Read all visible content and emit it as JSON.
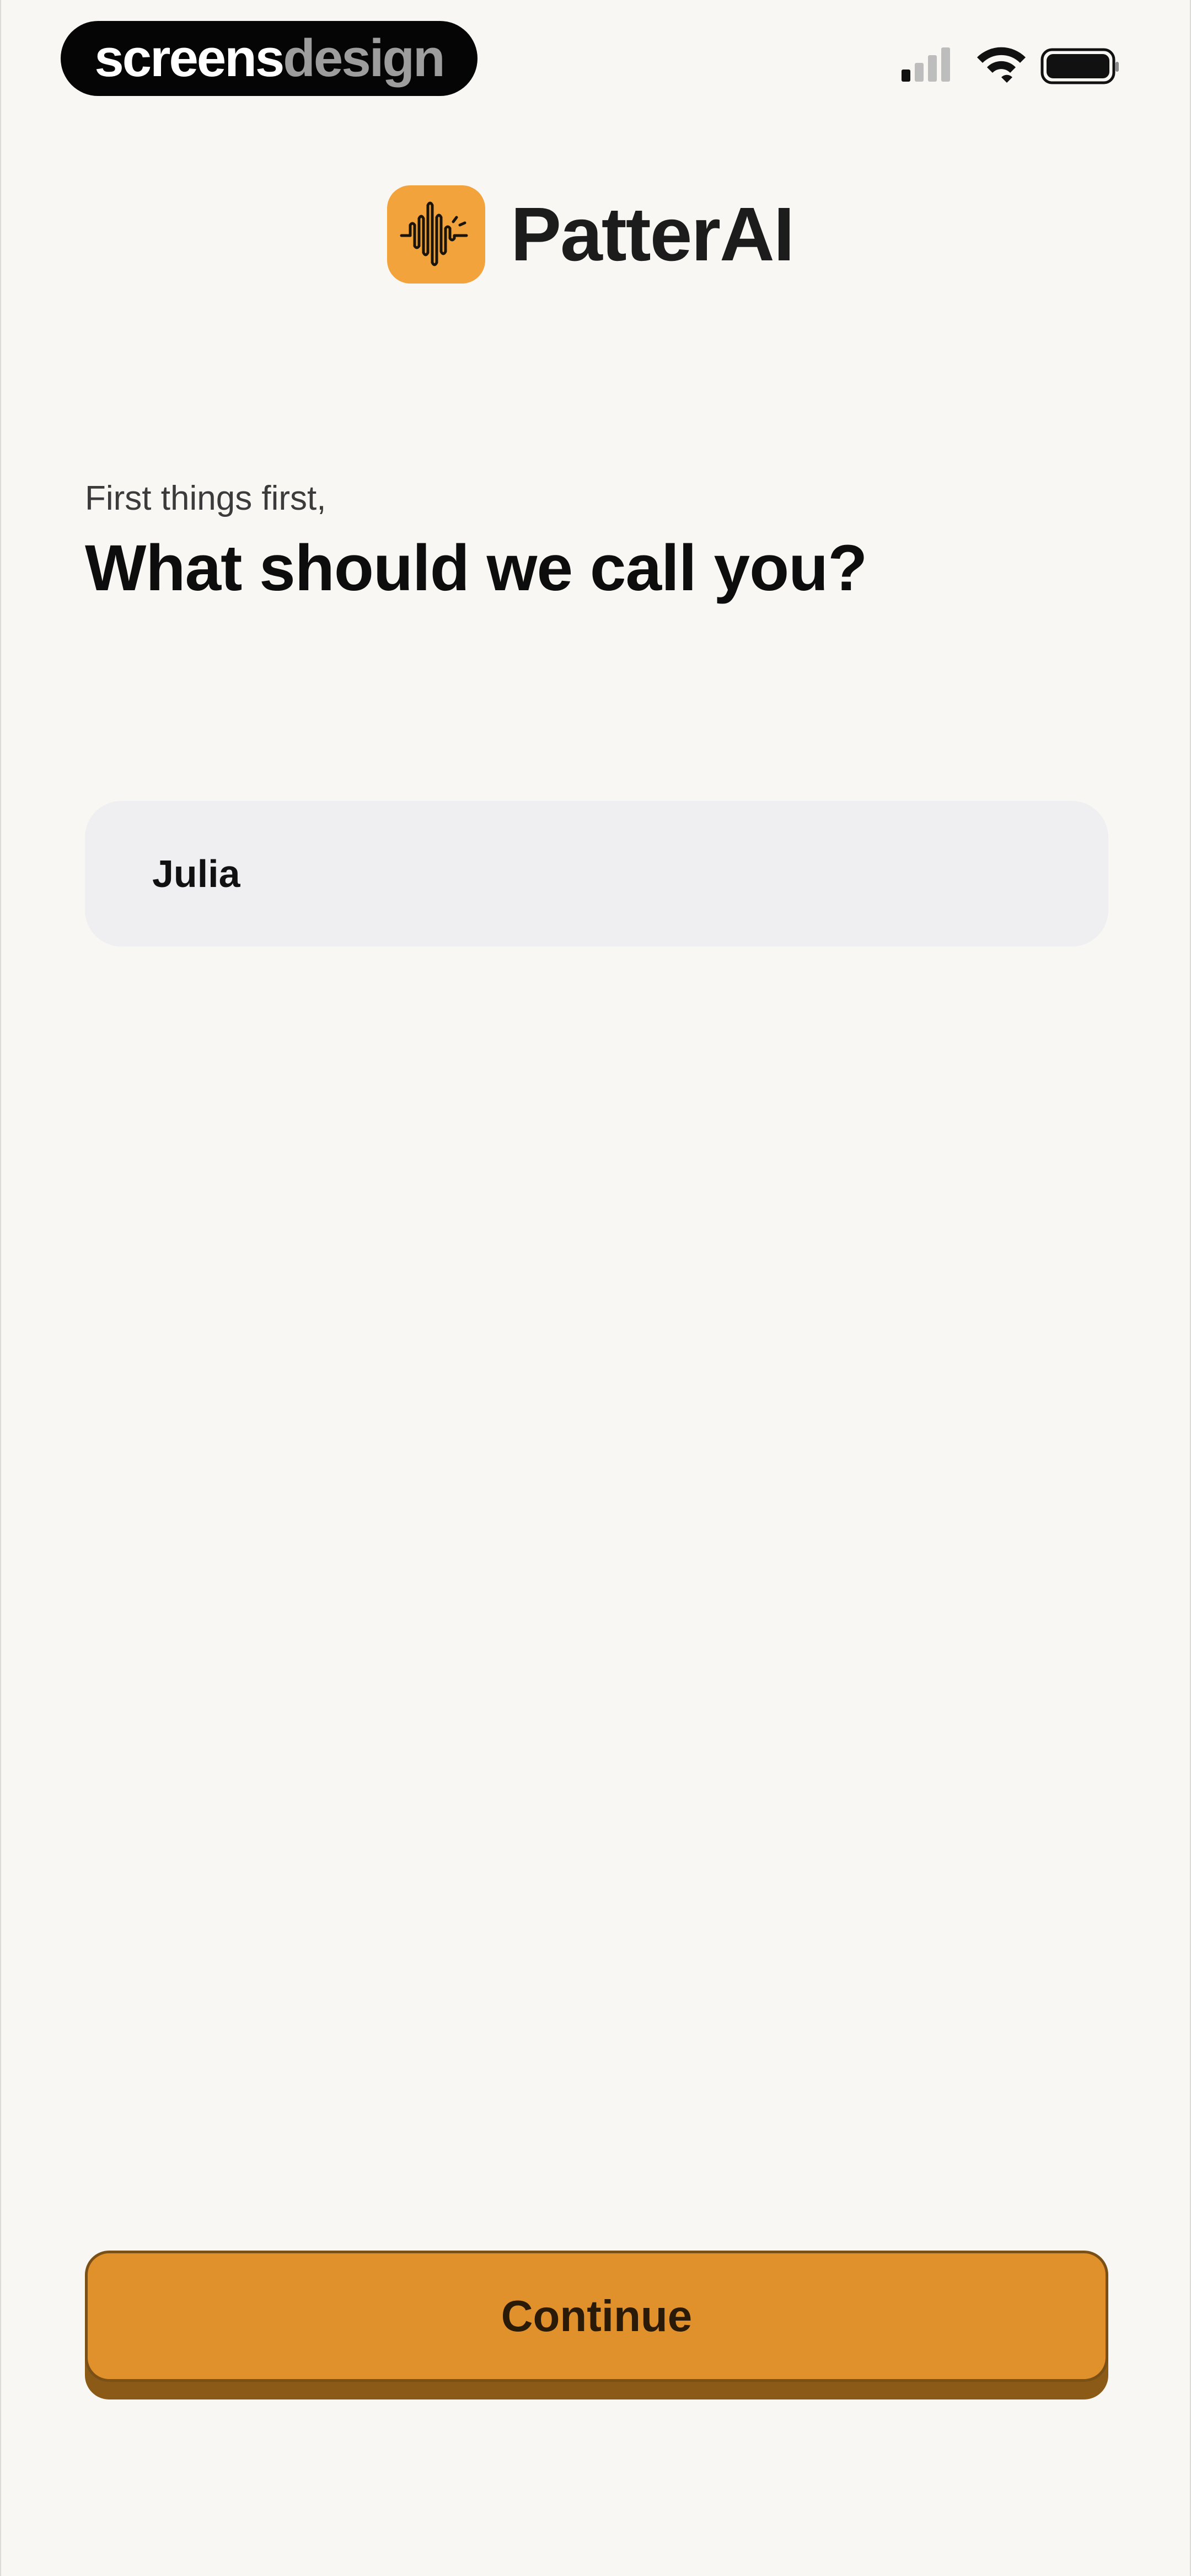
{
  "status_bar": {
    "brand_part1": "screens",
    "brand_part2": "design",
    "icons": [
      "cellular-signal-icon",
      "wifi-icon",
      "battery-icon"
    ]
  },
  "header": {
    "app_name": "PatterAI",
    "logo_icon": "sound-wave-icon",
    "logo_color": "#f2a33c"
  },
  "prompt": {
    "subtitle": "First things first,",
    "title": "What should we call you?"
  },
  "name_field": {
    "value": "Julia"
  },
  "footer": {
    "continue_label": "Continue",
    "button_color": "#e0912b"
  }
}
